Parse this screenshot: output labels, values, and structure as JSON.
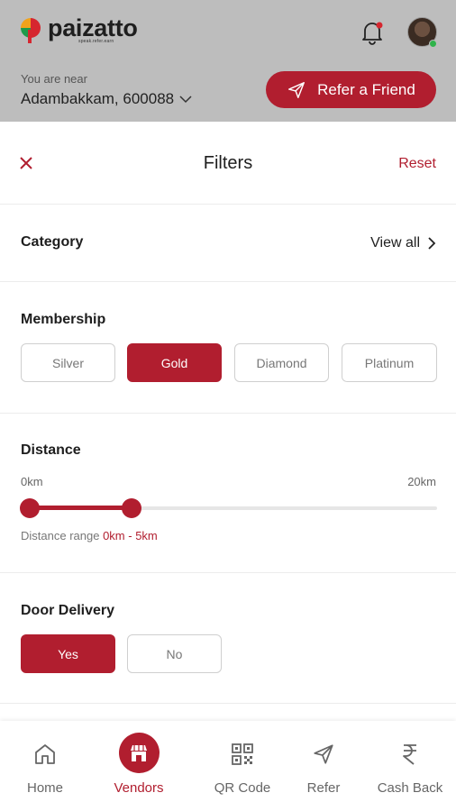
{
  "header": {
    "brand_name": "paizatto",
    "brand_tagline": "speak.refer.earn",
    "near_label": "You are near",
    "location": "Adambakkam, 600088",
    "refer_button": "Refer a Friend"
  },
  "filters": {
    "title": "Filters",
    "reset": "Reset",
    "category": {
      "title": "Category",
      "view_all": "View all"
    },
    "membership": {
      "title": "Membership",
      "options": [
        "Silver",
        "Gold",
        "Diamond",
        "Platinum"
      ],
      "selected": "Gold"
    },
    "distance": {
      "title": "Distance",
      "min_label": "0km",
      "max_label": "20km",
      "range_label": "Distance range",
      "range_value": "0km - 5km",
      "min_value_fraction": 0.0,
      "max_value_fraction": 0.25
    },
    "door_delivery": {
      "title": "Door Delivery",
      "options": [
        "Yes",
        "No"
      ],
      "selected": "Yes"
    }
  },
  "nav": {
    "items": [
      {
        "label": "Home",
        "icon": "home-icon"
      },
      {
        "label": "Vendors",
        "icon": "store-icon"
      },
      {
        "label": "QR Code",
        "icon": "qr-code-icon"
      },
      {
        "label": "Refer",
        "icon": "send-icon"
      },
      {
        "label": "Cash Back",
        "icon": "rupee-icon"
      }
    ],
    "active": "Vendors"
  },
  "colors": {
    "accent": "#b11e2f",
    "header_bg": "#bdbdbd",
    "online": "#2fb34a"
  }
}
